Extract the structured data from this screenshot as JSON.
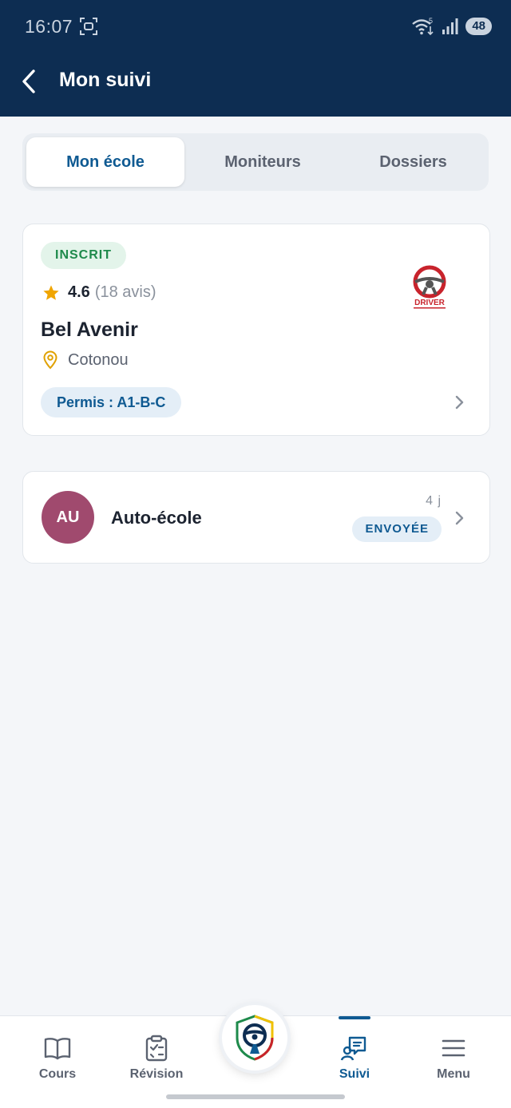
{
  "status_bar": {
    "time": "16:07",
    "battery": "48",
    "network_badge": "5"
  },
  "header": {
    "title": "Mon suivi"
  },
  "tabs": [
    {
      "label": "Mon école",
      "active": true
    },
    {
      "label": "Moniteurs",
      "active": false
    },
    {
      "label": "Dossiers",
      "active": false
    }
  ],
  "school": {
    "status": "INSCRIT",
    "rating": "4.6",
    "reviews": "(18 avis)",
    "name": "Bel Avenir",
    "city": "Cotonou",
    "permis": "Permis : A1-B-C",
    "logo_text": "DRIVER"
  },
  "dossier": {
    "initials": "AU",
    "title": "Auto-école",
    "time": "4 j",
    "status": "ENVOYÉE"
  },
  "bottom_nav": [
    {
      "label": "Cours",
      "icon": "book-icon"
    },
    {
      "label": "Révision",
      "icon": "clipboard-check-icon"
    },
    {
      "label": "Suivi",
      "icon": "chat-user-icon",
      "active": true
    },
    {
      "label": "Menu",
      "icon": "hamburger-icon"
    }
  ],
  "colors": {
    "header_bg": "#0d2d52",
    "accent": "#0f5a92",
    "success": "#1e8a4b",
    "avatar_bg": "#a04a6e",
    "star": "#f0a500"
  }
}
